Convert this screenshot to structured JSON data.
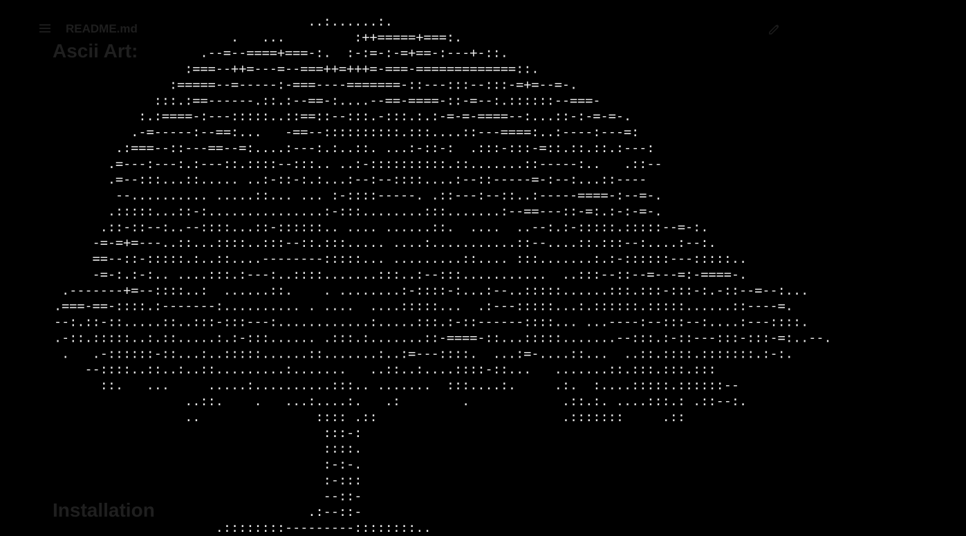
{
  "header": {
    "file_name": "README.md",
    "menu_icon": "hamburger-menu-icon",
    "edit_icon": "pencil-edit-icon"
  },
  "sections": {
    "ascii_heading": "Ascii Art:",
    "install_heading": "Installation"
  },
  "ascii_art": "                                        ..:......:.\n                              .   ...         :++=====+===:.\n                          .--=--====+===-:.  :-:=-:-=+==-:---+-::.\n                        :===--++=---=--===++=+++=-===-=============::.\n                      :=====--=-----:-===----=======-::---:::--:::-=+=--=-.\n                    :::.:==------.::.:--==-:....--==-====-::-=--:.::::::--===-\n                  :.:====-:---:::::..::==::--:::.-:::.:.:-=-=-====--:...::-:-=-=-.\n                 .-=-----:--==:...   -==--::::::::::.:::....::---====:..:----:---=:\n               .:===--::---==--=:....:---:.:..::. ...:-::-:  .:::-:::-=::.::.::.:---:\n              .=---:---:.:---::.::::--:::.. ..:-::::::::::.::.......::-----:..   .::--\n              .=--:::...::..... ..:-::-:.:...:--:--::::....:--::-----=-:--:...::----\n               --.......... .....::... ... :-::::-----. .::---:--::..:-----====-:--=-.\n              .:::::...::-:...............:-:::........:::.......:--==---::-=:.:-:-=-.\n             .::-::--:..--::::...::-::::::.. .... ......::.  ....  ..--:.:-:::::.:::::--=-:.\n            -=-=+=---..::...::::..:::--::.:::..... ....:...........::--....::.:::--:....:--:.\n            ==--::-:::::.:..::....--------:::::... .........::.... :::.......:.:-::::::---:::::..\n            -=-:.:-:.. ....:::.:---:..::::.......:::..:--:::...........  ..:::--::--=---=:-====-.\n        .-------+=--::::..:  ......::.    . ........:-::::-:...:--..:::::......:::.:::-:::-:.-::--=--:...\n       .===-==-::::.:-------:.......... . ....  ....:::::...  .:---:::::...:.::::::.:::::......::----=.\n       --:.::-::.....::..:::-:::---:............:.....:::.:-::------::::... ...----:--:::--:....:---::::.\n       .-::.:::::..:.::.....:.:-:::...... .:::.:.......::-====-::...:::::.......--:::.:-::---:::-:::-=:..--.\n        .   .-::::::-::...:..:::::......::.......:..:=---::::.  ...:=-....::...  ..::.::::.:::::::.:-:.\n           --::::..::..:..::.........:.......   ..::..:....::::-::...   .......::.:::.:::.:::\n             ::.   ...     .....:..........:::.. .......  :::....:.     .:.  :....:::::.::::::--\n                        ..::.    .   ...:....:.   .:        .            .::.:. ....:::.: .::--:.\n                        ..               :::: .::                        .:::::::     .::\n                                          :::-:\n                                          ::::.\n                                          :-:-.\n                                          :-:::\n                                          --::-\n                                        .:--::-\n                            .::::::::---------::::::::.."
}
